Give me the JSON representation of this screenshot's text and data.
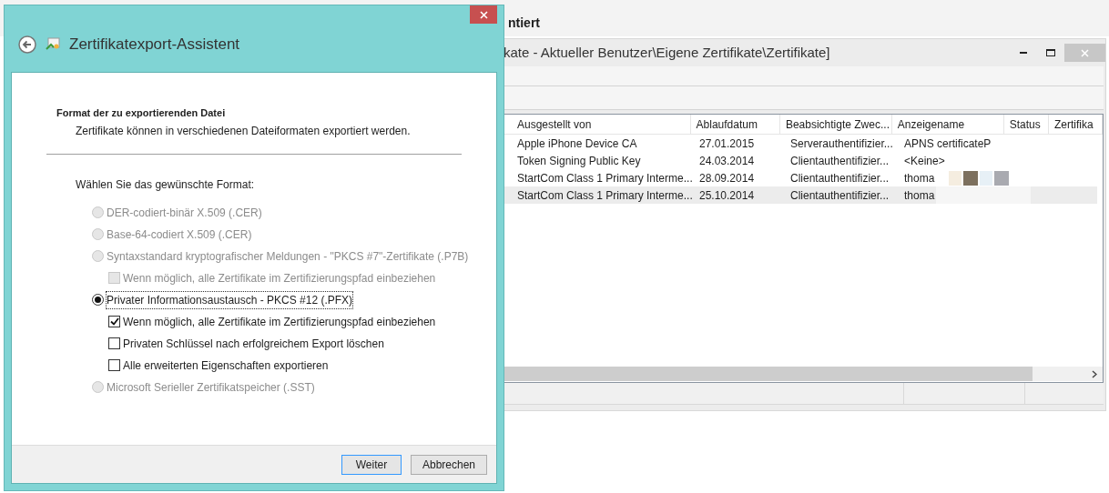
{
  "background": {
    "heading": "ntiert",
    "window_title": "kate - Aktueller Benutzer\\Eigene Zertifikate\\Zertifikate]",
    "columns": [
      "Ausgestellt von",
      "Ablaufdatum",
      "Beabsichtigte Zwec...",
      "Anzeigename",
      "Status",
      "Zertifika"
    ],
    "rows": [
      {
        "cells": [
          "Apple iPhone Device CA",
          "27.01.2015",
          "Serverauthentifizier...",
          "APNS certificateP"
        ],
        "selected": false
      },
      {
        "cells": [
          "Token Signing Public Key",
          "24.03.2014",
          "Clientauthentifizier...",
          "<Keine>"
        ],
        "selected": false
      },
      {
        "cells": [
          "StartCom Class 1 Primary Interme...",
          "28.09.2014",
          "Clientauthentifizier...",
          "thoma"
        ],
        "selected": false
      },
      {
        "cells": [
          "StartCom Class 1 Primary Interme...",
          "25.10.2014",
          "Clientauthentifizier...",
          "thoma"
        ],
        "selected": true
      }
    ]
  },
  "dialog": {
    "title": "Zertifikatexport-Assistent",
    "section_title": "Format der zu exportierenden Datei",
    "section_subtitle": "Zertifikate können in verschiedenen Dateiformaten exportiert werden.",
    "prompt": "Wählen Sie das gewünschte Format:",
    "options": [
      {
        "label": "DER-codiert-binär X.509 (.CER)",
        "selected": false,
        "disabled": true
      },
      {
        "label": "Base-64-codiert X.509 (.CER)",
        "selected": false,
        "disabled": true
      },
      {
        "label": "Syntaxstandard kryptografischer Meldungen - \"PKCS #7\"-Zertifikate (.P7B)",
        "selected": false,
        "disabled": true,
        "suboptions": [
          {
            "label": "Wenn möglich, alle Zertifikate im Zertifizierungspfad einbeziehen",
            "checked": false,
            "disabled": true
          }
        ]
      },
      {
        "label": "Privater Informationsaustausch - PKCS #12 (.PFX)",
        "selected": true,
        "disabled": false,
        "suboptions": [
          {
            "label": "Wenn möglich, alle Zertifikate im Zertifizierungspfad einbeziehen",
            "checked": true,
            "disabled": false
          },
          {
            "label": "Privaten Schlüssel nach erfolgreichem Export löschen",
            "checked": false,
            "disabled": false
          },
          {
            "label": "Alle erweiterten Eigenschaften exportieren",
            "checked": false,
            "disabled": false
          }
        ]
      },
      {
        "label": "Microsoft Serieller Zertifikatspeicher (.SST)",
        "selected": false,
        "disabled": true
      }
    ],
    "buttons": [
      {
        "label": "Weiter",
        "default": true
      },
      {
        "label": "Abbrechen",
        "default": false
      }
    ]
  }
}
